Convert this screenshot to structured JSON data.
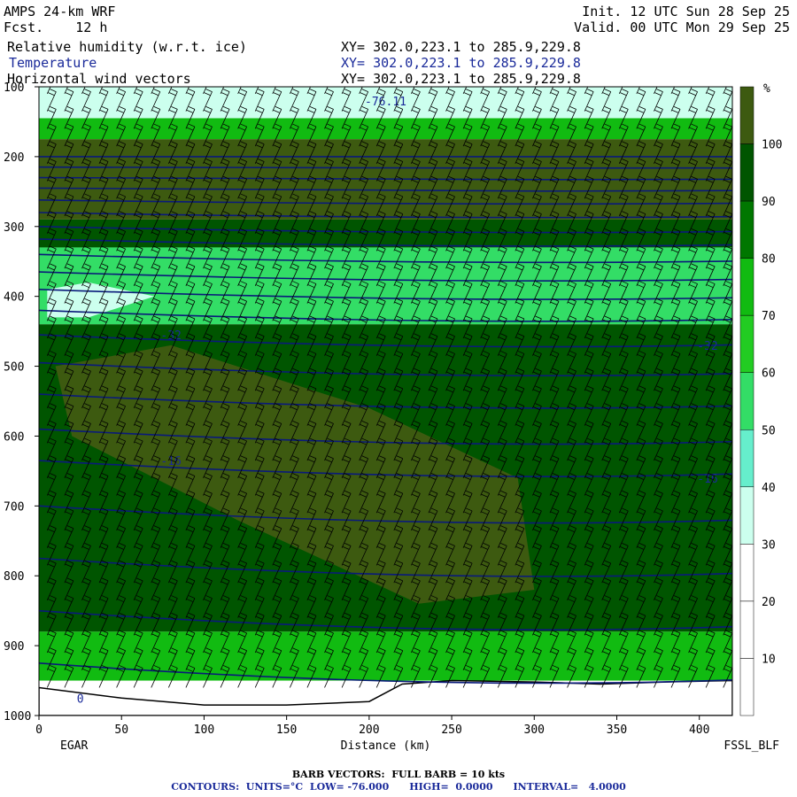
{
  "header": {
    "model": "AMPS 24-km WRF",
    "fcst": "Fcst.    12 h",
    "init": "Init. 12 UTC Sun 28 Sep 25",
    "valid": "Valid. 00 UTC Mon 29 Sep 25",
    "field1_label": "Relative humidity (w.r.t. ice)",
    "field2_label": "Temperature",
    "field3_label": "Horizontal wind vectors",
    "field1_xy": "XY= 302.0,223.1 to 285.9,229.8",
    "field2_xy": "XY= 302.0,223.1 to 285.9,229.8",
    "field3_xy": "XY= 302.0,223.1 to 285.9,229.8"
  },
  "footer": {
    "barb_note": "BARB VECTORS:  FULL BARB = 10 kts",
    "contours_note": "CONTOURS:  UNITS=°C  LOW= -76.000      HIGH=  0.0000      INTERVAL=   4.0000"
  },
  "chart_data": {
    "type": "heatmap",
    "title": "",
    "xlabel": "Distance (km)",
    "ylabel": "",
    "x_start_label": "EGAR",
    "x_end_label": "FSSL_BLF",
    "xlim": [
      0,
      420
    ],
    "ylim": [
      1000,
      100
    ],
    "x_ticks": [
      0,
      50,
      100,
      150,
      200,
      250,
      300,
      350,
      400
    ],
    "y_ticks": [
      100,
      200,
      300,
      400,
      500,
      600,
      700,
      800,
      900,
      1000
    ],
    "colorbar": {
      "unit": "%",
      "levels": [
        10,
        20,
        30,
        40,
        50,
        60,
        70,
        80,
        90,
        100
      ],
      "colors": [
        "#ffffff",
        "#ffffff",
        "#ffffff",
        "#ccffee",
        "#66eecc",
        "#33dd66",
        "#22cc22",
        "#11bb11",
        "#007700",
        "#005500",
        "#3d5a10"
      ]
    },
    "rh_layers": [
      {
        "p_top": 100,
        "p_bot": 145,
        "rh": 35
      },
      {
        "p_top": 145,
        "p_bot": 175,
        "rh": 75
      },
      {
        "p_top": 175,
        "p_bot": 290,
        "rh": 100
      },
      {
        "p_top": 290,
        "p_bot": 330,
        "rh": 90
      },
      {
        "p_top": 330,
        "p_bot": 440,
        "rh": 55
      },
      {
        "p_top": 440,
        "p_bot": 880,
        "rh": 90
      },
      {
        "p_top": 880,
        "p_bot": 950,
        "rh": 75
      }
    ],
    "rh_features": [
      {
        "name": "moist tongue",
        "rh": 100,
        "x": [
          10,
          80,
          200,
          290,
          300,
          230,
          120,
          20
        ],
        "p": [
          500,
          470,
          560,
          660,
          820,
          840,
          720,
          600
        ]
      },
      {
        "name": "dry pocket",
        "rh": 35,
        "x": [
          5,
          30,
          70,
          30,
          5
        ],
        "p": [
          390,
          380,
          400,
          430,
          430
        ]
      }
    ],
    "temperature_contours": [
      {
        "label": "-76.11",
        "p_left": 120,
        "p_right": 120
      },
      {
        "label": "-32",
        "p_left": 455,
        "p_right": 470
      },
      {
        "label": "-16",
        "p_left": 635,
        "p_right": 660
      },
      {
        "label": "0",
        "p_left": 975,
        "p_right": 975
      }
    ],
    "isotherm_levels_p_left": [
      200,
      215,
      230,
      245,
      262,
      280,
      300,
      318,
      340,
      365,
      390,
      420,
      455,
      495,
      540,
      590,
      635,
      700,
      775,
      850,
      925
    ],
    "terrain_surface_p": [
      {
        "x": 0,
        "p": 960
      },
      {
        "x": 50,
        "p": 975
      },
      {
        "x": 100,
        "p": 985
      },
      {
        "x": 150,
        "p": 985
      },
      {
        "x": 200,
        "p": 980
      },
      {
        "x": 220,
        "p": 955
      },
      {
        "x": 250,
        "p": 950
      },
      {
        "x": 300,
        "p": 952
      },
      {
        "x": 340,
        "p": 955
      },
      {
        "x": 380,
        "p": 952
      },
      {
        "x": 420,
        "p": 950
      }
    ]
  }
}
